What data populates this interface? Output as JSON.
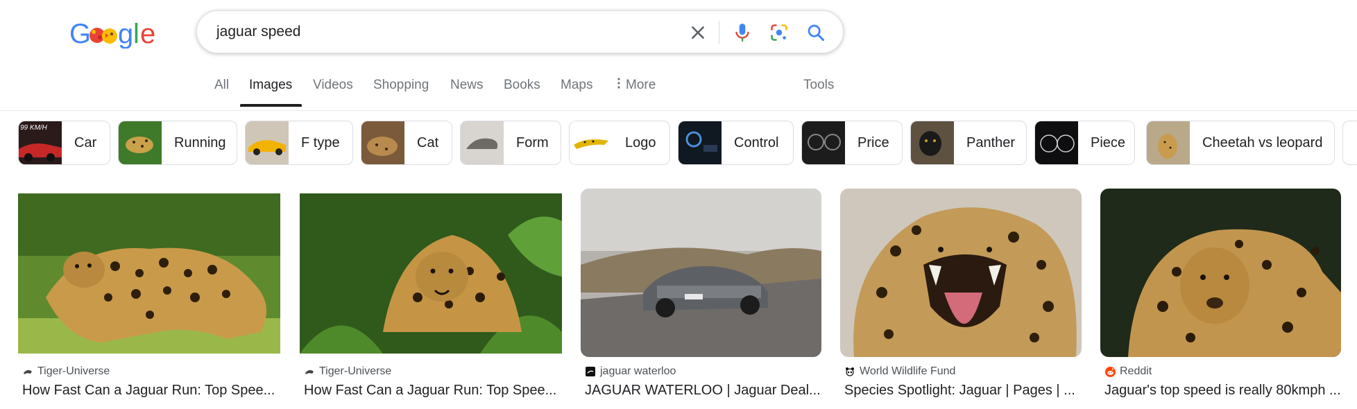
{
  "search": {
    "query": "jaguar speed"
  },
  "logo": {
    "text": "Google"
  },
  "tabs": [
    {
      "label": "All"
    },
    {
      "label": "Images",
      "active": true
    },
    {
      "label": "Videos"
    },
    {
      "label": "Shopping"
    },
    {
      "label": "News"
    },
    {
      "label": "Books"
    },
    {
      "label": "Maps"
    },
    {
      "label": "More"
    }
  ],
  "tools_label": "Tools",
  "chips": [
    {
      "label": "Car"
    },
    {
      "label": "Running"
    },
    {
      "label": "F type"
    },
    {
      "label": "Cat"
    },
    {
      "label": "Form"
    },
    {
      "label": "Logo"
    },
    {
      "label": "Control"
    },
    {
      "label": "Price"
    },
    {
      "label": "Panther"
    },
    {
      "label": "Piece"
    },
    {
      "label": "Cheetah vs leopard"
    }
  ],
  "chip_thumb_text": {
    "car": "99 KM/H"
  },
  "results": [
    {
      "source": "Tiger-Universe",
      "title": "How Fast Can a Jaguar Run: Top Spee..."
    },
    {
      "source": "Tiger-Universe",
      "title": "How Fast Can a Jaguar Run: Top Spee..."
    },
    {
      "source": "jaguar waterloo",
      "title": "JAGUAR WATERLOO | Jaguar Deal..."
    },
    {
      "source": "World Wildlife Fund",
      "title": "Species Spotlight: Jaguar | Pages | ..."
    },
    {
      "source": "Reddit",
      "title": "Jaguar's top speed is really 80kmph ..."
    }
  ],
  "icons": {
    "clear": "close-icon",
    "voice": "microphone-icon",
    "lens": "camera-lens-icon",
    "search": "search-icon",
    "more": "more-vertical-icon"
  },
  "colors": {
    "google_blue": "#4285F4",
    "google_red": "#EA4335",
    "google_yellow": "#FBBC05",
    "google_green": "#34A853"
  }
}
